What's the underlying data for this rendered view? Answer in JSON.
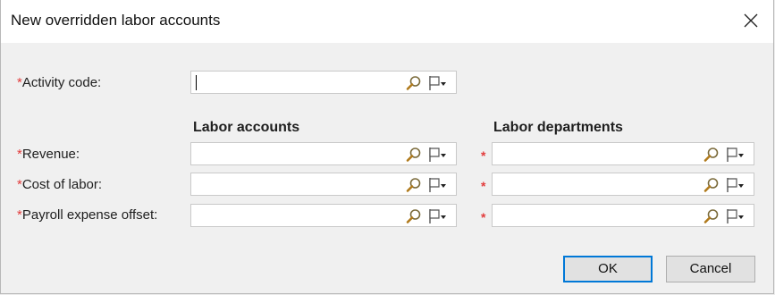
{
  "dialog": {
    "title": "New overridden labor accounts",
    "close_icon": "close-icon"
  },
  "activity": {
    "label": "Activity code:",
    "value": ""
  },
  "columns": {
    "accounts_header": "Labor accounts",
    "departments_header": "Labor departments"
  },
  "rows": [
    {
      "label": "Revenue:",
      "account_value": "",
      "department_value": ""
    },
    {
      "label": "Cost of labor:",
      "account_value": "",
      "department_value": ""
    },
    {
      "label": "Payroll expense offset:",
      "account_value": "",
      "department_value": ""
    }
  ],
  "required_mark": "*",
  "icons": {
    "lookup": "magnifier-icon",
    "options": "flag-dropdown-icon"
  },
  "buttons": {
    "ok": "OK",
    "cancel": "Cancel"
  },
  "colors": {
    "required": "#e23b3b",
    "focus": "#0078d7"
  }
}
